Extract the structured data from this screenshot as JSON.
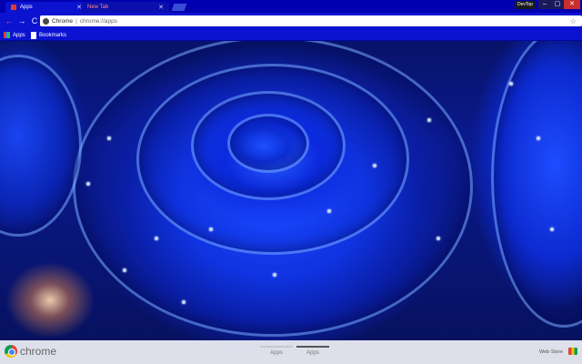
{
  "tabs": [
    {
      "label": "Apps",
      "state": "active"
    },
    {
      "label": "New Tab",
      "state": "inactive"
    }
  ],
  "window": {
    "profile_label": "DevTop",
    "close_glyph": "✕",
    "min_glyph": "–",
    "max_glyph": "▢"
  },
  "toolbar": {
    "back_glyph": "←",
    "forward_glyph": "→",
    "reload_glyph": "C",
    "omnibox": {
      "chip": "Chrome",
      "separator": "|",
      "url": "chrome://apps",
      "star_glyph": "☆"
    }
  },
  "bookmarks": {
    "apps_label": "Apps",
    "bookmarks_label": "Bookmarks"
  },
  "bottom_bar": {
    "wordmark": "chrome",
    "page_tabs": [
      "Apps",
      "Apps"
    ],
    "webstore_label": "Web Store"
  },
  "icons": {
    "tab_favicon": "red-square-icon",
    "apps_icon": "grid-icon",
    "bookmarks_icon": "page-icon",
    "omnibox_icon": "chrome-icon",
    "webstore_icon": "webstore-icon"
  },
  "colors": {
    "frame": "#0b13d0",
    "tabstrip": "#0000b0",
    "close": "#c9302c"
  }
}
